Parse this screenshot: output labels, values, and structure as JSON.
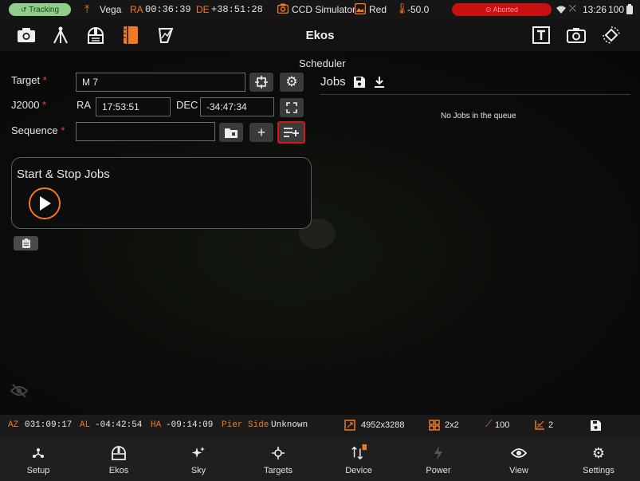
{
  "status_bar": {
    "tracking": "Tracking",
    "target": "Vega",
    "ra_label": "RA",
    "ra_value": "00:36:39",
    "de_label": "DE",
    "de_value": "+38:51:28",
    "camera": "CCD Simulator",
    "filter": "Red",
    "temperature": "-50.0",
    "capture_state": "Aborted",
    "time": "13:26",
    "battery": "100"
  },
  "toolbar": {
    "title": "Ekos"
  },
  "scheduler": {
    "module_title": "Scheduler",
    "target_label": "Target",
    "target_value": "M 7",
    "j2000_label": "J2000",
    "ra_label": "RA",
    "ra_value": "17:53:51",
    "dec_label": "DEC",
    "dec_value": "-34:47:34",
    "sequence_label": "Sequence",
    "sequence_value": "",
    "required_mark": "*",
    "start_stop_title": "Start & Stop Jobs",
    "jobs_title": "Jobs",
    "no_jobs_text": "No Jobs in the queue"
  },
  "info_bar": {
    "az_label": "AZ",
    "az_value": "031:09:17",
    "al_label": "AL",
    "al_value": "-04:42:54",
    "ha_label": "HA",
    "ha_value": "-09:14:09",
    "pier_label": "Pier Side",
    "pier_value": "Unknown",
    "frame_size": "4952x3288",
    "binning": "2x2",
    "gain": "100",
    "offset": "2"
  },
  "bottom_nav": {
    "items": [
      {
        "label": "Setup"
      },
      {
        "label": "Ekos"
      },
      {
        "label": "Sky"
      },
      {
        "label": "Targets"
      },
      {
        "label": "Device"
      },
      {
        "label": "Power"
      },
      {
        "label": "View"
      },
      {
        "label": "Settings"
      }
    ]
  },
  "colors": {
    "accent": "#f07a24",
    "tracking_green": "#8fcf8a",
    "aborted_red": "#c80f12",
    "required_red": "#e04a3a"
  }
}
